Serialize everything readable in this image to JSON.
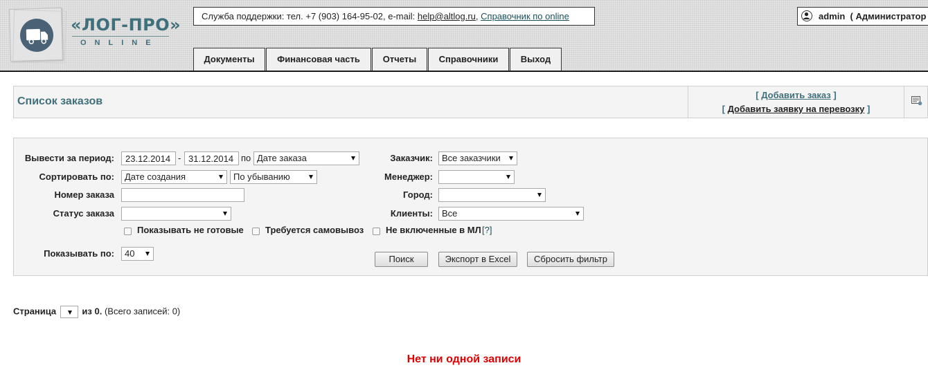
{
  "header": {
    "logo_text": "«ЛОГ-ПРО»",
    "logo_sub": "ONLINE",
    "support_text": "Служба поддержки: тел. +7 (903) 164-95-02, e-mail: ",
    "support_email": "help@altlog.ru",
    "support_sep": ",",
    "support_link": "Справочник по online",
    "user_name": "admin",
    "user_role": "( Администратор"
  },
  "nav": [
    {
      "label": "Документы"
    },
    {
      "label": "Финансовая часть"
    },
    {
      "label": "Отчеты"
    },
    {
      "label": "Справочники"
    },
    {
      "label": "Выход"
    }
  ],
  "title_bar": {
    "title": "Список заказов",
    "add_order": "Добавить заказ",
    "add_request": "Добавить заявку на перевозку",
    "bracket_open": "[",
    "bracket_close": "]"
  },
  "filter": {
    "period_label": "Вывести за период:",
    "date_from": "23.12.2014",
    "date_sep": "-",
    "date_to": "31.12.2014",
    "by_label": "по",
    "by_value": "Дате заказа",
    "sort_label": "Сортировать по:",
    "sort_field": "Дате создания",
    "sort_order": "По убыванию",
    "order_num_label": "Номер заказа",
    "order_num_value": "",
    "status_label": "Статус заказа",
    "status_value": "",
    "customer_label": "Заказчик:",
    "customer_value": "Все заказчики",
    "manager_label": "Менеджер:",
    "manager_value": "",
    "city_label": "Город:",
    "city_value": "",
    "clients_label": "Клиенты:",
    "clients_value": "Все",
    "chk_not_ready": "Показывать не готовые",
    "chk_pickup": "Требуется самовывоз",
    "chk_not_in_ml": "Не включенные в МЛ",
    "help_mark": "[?]",
    "show_by_label": "Показывать по:",
    "show_by_value": "40",
    "btn_search": "Поиск",
    "btn_export": "Экспорт в Excel",
    "btn_reset": "Сбросить фильтр"
  },
  "pager": {
    "page_label": "Страница",
    "of_text": "из 0.",
    "total_text": "(Всего записей: 0)"
  },
  "empty_message": "Нет ни одной записи"
}
